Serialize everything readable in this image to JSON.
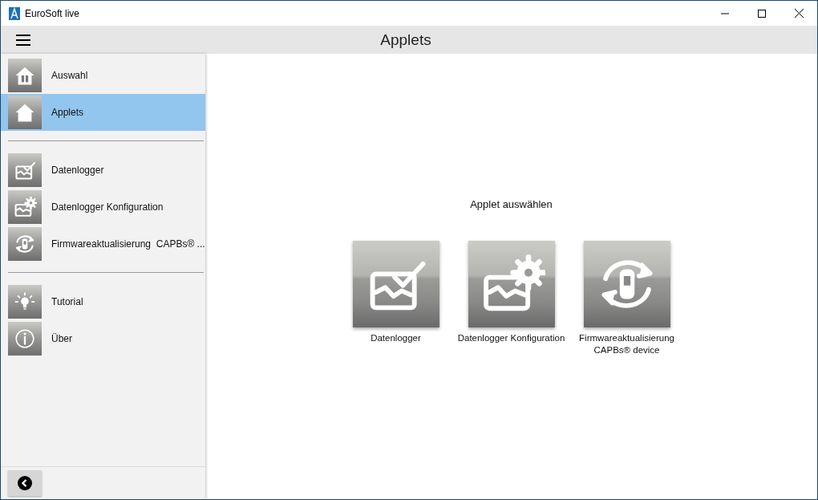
{
  "window": {
    "title": "EuroSoft live"
  },
  "header": {
    "title": "Applets"
  },
  "sidebar": {
    "groups": [
      [
        {
          "label": "Auswahl",
          "kind": "house-device",
          "selected": false
        },
        {
          "label": "Applets",
          "kind": "house",
          "selected": true
        }
      ],
      [
        {
          "label": "Datenlogger",
          "kind": "chart-check",
          "selected": false
        },
        {
          "label": "Datenlogger Konfiguration",
          "kind": "chart-gear",
          "selected": false
        },
        {
          "label": "Firmwareaktualisierung  CAPBs® ...",
          "kind": "sync-device",
          "selected": false
        }
      ],
      [
        {
          "label": "Tutorial",
          "kind": "bulb",
          "selected": false
        },
        {
          "label": "Über",
          "kind": "info",
          "selected": false
        }
      ]
    ]
  },
  "main": {
    "heading": "Applet auswählen",
    "tiles": [
      {
        "label": "Datenlogger",
        "kind": "chart-check"
      },
      {
        "label": "Datenlogger Konfiguration",
        "kind": "chart-gear"
      },
      {
        "label": "Firmwareaktualisierung CAPBs® device",
        "kind": "sync-device"
      }
    ]
  }
}
